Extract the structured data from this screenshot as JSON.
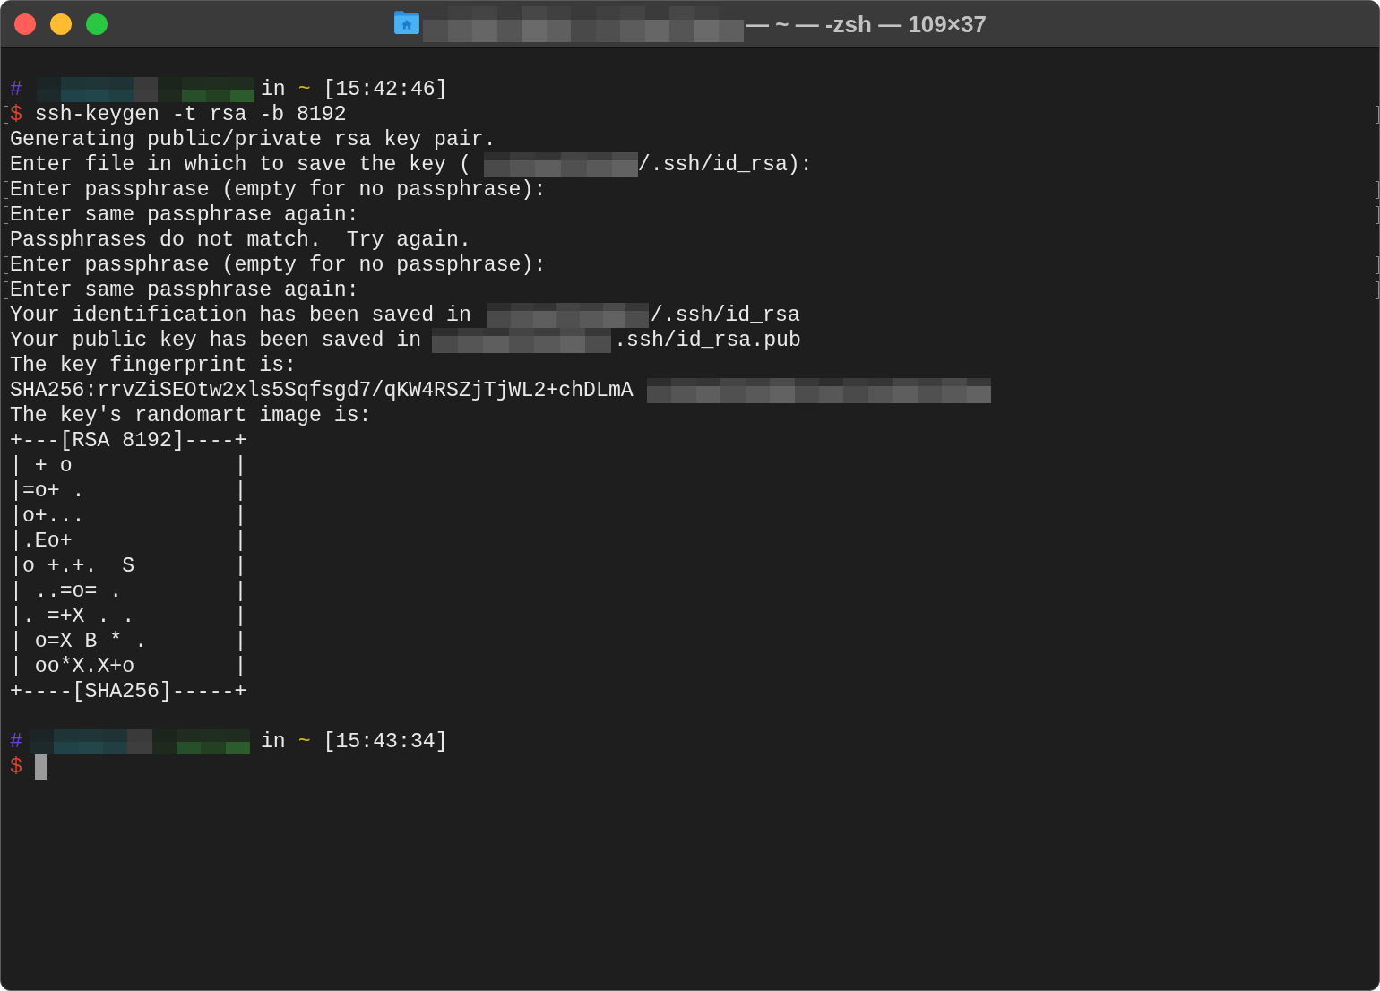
{
  "window": {
    "buttons": [
      {
        "kind": "close"
      },
      {
        "kind": "minimize"
      },
      {
        "kind": "zoom"
      }
    ],
    "title_parts": [
      {
        "kind": "redacted"
      },
      {
        "kind": "text",
        "text": "— ~ — -zsh — 109×37"
      }
    ]
  },
  "terminal": {
    "lines": [
      {
        "marked": false,
        "segments": [
          {
            "kind": "symbol",
            "text": "#",
            "color": "#6b40f0"
          },
          {
            "kind": "redacted"
          },
          {
            "kind": "text",
            "text": "in"
          },
          {
            "kind": "directory",
            "text": "~",
            "color": "#c7b92a"
          },
          {
            "kind": "time",
            "text": "[15:42:46]"
          }
        ]
      },
      {
        "marked": true,
        "segments": [
          {
            "kind": "symbol",
            "text": "$",
            "color": "#d8432b"
          },
          {
            "kind": "command",
            "text": "ssh-keygen -t rsa -b 8192"
          }
        ]
      },
      {
        "marked": false,
        "segments": [
          {
            "kind": "text",
            "text": "Generating public/private rsa key pair."
          }
        ]
      },
      {
        "marked": false,
        "segments": [
          {
            "kind": "text",
            "text": "Enter file in which to save the key ("
          },
          {
            "kind": "redacted"
          },
          {
            "kind": "text",
            "text": "/.ssh/id_rsa):"
          }
        ]
      },
      {
        "marked": true,
        "segments": [
          {
            "kind": "text",
            "text": "Enter passphrase (empty for no passphrase):"
          }
        ]
      },
      {
        "marked": true,
        "segments": [
          {
            "kind": "text",
            "text": "Enter same passphrase again:"
          }
        ]
      },
      {
        "marked": false,
        "segments": [
          {
            "kind": "text",
            "text": "Passphrases do not match.  Try again."
          }
        ]
      },
      {
        "marked": true,
        "segments": [
          {
            "kind": "text",
            "text": "Enter passphrase (empty for no passphrase):"
          }
        ]
      },
      {
        "marked": true,
        "segments": [
          {
            "kind": "text",
            "text": "Enter same passphrase again:"
          }
        ]
      },
      {
        "marked": false,
        "segments": [
          {
            "kind": "text",
            "text": "Your identification has been saved in"
          },
          {
            "kind": "redacted"
          },
          {
            "kind": "text",
            "text": "/.ssh/id_rsa"
          }
        ]
      },
      {
        "marked": false,
        "segments": [
          {
            "kind": "text",
            "text": "Your public key has been saved in"
          },
          {
            "kind": "redacted"
          },
          {
            "kind": "text",
            "text": ".ssh/id_rsa.pub"
          }
        ]
      },
      {
        "marked": false,
        "segments": [
          {
            "kind": "text",
            "text": "The key fingerprint is:"
          }
        ]
      },
      {
        "marked": false,
        "segments": [
          {
            "kind": "text",
            "text": "SHA256:rrvZiSEOtw2xls5Sqfsgd7/qKW4RSZjTjWL2+chDLmA"
          },
          {
            "kind": "redacted"
          }
        ]
      },
      {
        "marked": false,
        "segments": [
          {
            "kind": "text",
            "text": "The key's randomart image is:"
          }
        ]
      },
      {
        "marked": false,
        "segments": [
          {
            "kind": "art",
            "text": "+---[RSA 8192]----+"
          }
        ]
      },
      {
        "marked": false,
        "segments": [
          {
            "kind": "art",
            "text": "| + o             |"
          }
        ]
      },
      {
        "marked": false,
        "segments": [
          {
            "kind": "art",
            "text": "|=o+ .            |"
          }
        ]
      },
      {
        "marked": false,
        "segments": [
          {
            "kind": "art",
            "text": "|o+...            |"
          }
        ]
      },
      {
        "marked": false,
        "segments": [
          {
            "kind": "art",
            "text": "|.Eo+             |"
          }
        ]
      },
      {
        "marked": false,
        "segments": [
          {
            "kind": "art",
            "text": "|o +.+.  S        |"
          }
        ]
      },
      {
        "marked": false,
        "segments": [
          {
            "kind": "art",
            "text": "| ..=o= .         |"
          }
        ]
      },
      {
        "marked": false,
        "segments": [
          {
            "kind": "art",
            "text": "|. =+X . .        |"
          }
        ]
      },
      {
        "marked": false,
        "segments": [
          {
            "kind": "art",
            "text": "| o=X B * .       |"
          }
        ]
      },
      {
        "marked": false,
        "segments": [
          {
            "kind": "art",
            "text": "| oo*X.X+o        |"
          }
        ]
      },
      {
        "marked": false,
        "segments": [
          {
            "kind": "art",
            "text": "+----[SHA256]-----+"
          }
        ]
      },
      {
        "marked": false
      },
      {
        "marked": false,
        "segments": [
          {
            "kind": "symbol",
            "text": "#",
            "color": "#6b40f0"
          },
          {
            "kind": "redacted"
          },
          {
            "kind": "text",
            "text": "in"
          },
          {
            "kind": "directory",
            "text": "~",
            "color": "#c7b92a"
          },
          {
            "kind": "time",
            "text": "[15:43:34]"
          }
        ]
      },
      {
        "marked": false,
        "segments": [
          {
            "kind": "symbol",
            "text": "$",
            "color": "#d8432b"
          },
          {
            "kind": "cursor"
          }
        ]
      }
    ]
  }
}
